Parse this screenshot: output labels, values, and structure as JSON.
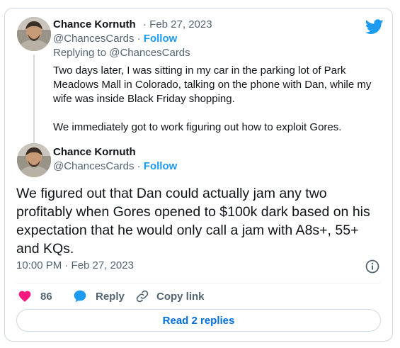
{
  "first_tweet": {
    "author_name": "Chance Kornuth",
    "date_text": "· Feb 27, 2023",
    "handle": "@ChancesCards",
    "separator": "·",
    "follow_label": "Follow",
    "replying_to": "Replying to @ChancesCards",
    "paragraph_1": "Two days later, I was sitting in my car in the parking lot of Park Meadows Mall in Colorado, talking on the phone with Dan, while my wife was inside Black Friday shopping.",
    "paragraph_2": "We immediately got to work figuring out how to exploit Gores."
  },
  "main_tweet": {
    "author_name": "Chance Kornuth",
    "handle": "@ChancesCards",
    "separator": "·",
    "follow_label": "Follow",
    "text": "We figured out that Dan could actually jam any two profitably when Gores opened to $100k dark based on his expectation that he would only call a jam with A8s+, 55+ and KQs.",
    "timestamp": "10:00 PM · Feb 27, 2023"
  },
  "actions": {
    "like_count": "86",
    "reply_label": "Reply",
    "copy_link_label": "Copy link"
  },
  "read_replies_label": "Read 2 replies",
  "icons": {
    "brand": "twitter-bird-icon",
    "like": "heart-icon",
    "reply": "speech-bubble-icon",
    "copy": "link-icon",
    "info": "info-icon"
  },
  "colors": {
    "accent": "#1d9bf0",
    "like": "#f91880",
    "text": "#0f1419",
    "muted": "#536471",
    "border": "#cfd9de"
  }
}
